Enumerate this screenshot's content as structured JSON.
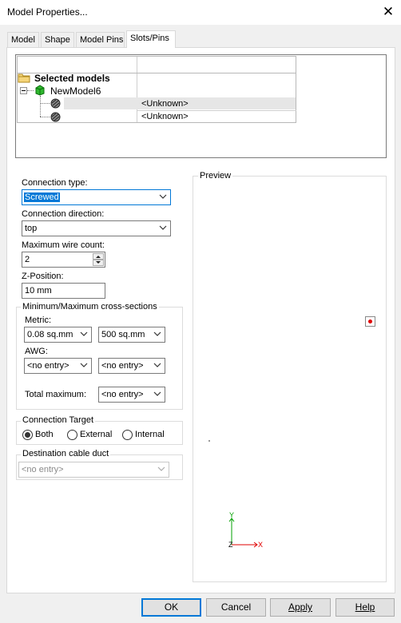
{
  "window": {
    "title": "Model Properties..."
  },
  "tabs": [
    "Model",
    "Shape",
    "Model Pins",
    "Slots/Pins"
  ],
  "tree": {
    "root_label": "Selected models",
    "model_label": "NewModel6",
    "rows": [
      {
        "value": "<Unknown>"
      },
      {
        "value": "<Unknown>"
      }
    ]
  },
  "form": {
    "connection_type": {
      "label": "Connection type:",
      "value": "Screwed"
    },
    "connection_direction": {
      "label": "Connection direction:",
      "value": "top"
    },
    "max_wire_count": {
      "label": "Maximum wire count:",
      "value": "2"
    },
    "z_position": {
      "label": "Z-Position:",
      "value": "10 mm"
    },
    "cross_sections": {
      "title": "Minimum/Maximum cross-sections",
      "metric_label": "Metric:",
      "metric_min": "0.08 sq.mm",
      "metric_max": "500 sq.mm",
      "awg_label": "AWG:",
      "awg_min": "<no entry>",
      "awg_max": "<no entry>",
      "total_label": "Total maximum:",
      "total_value": "<no entry>"
    },
    "connection_target": {
      "title": "Connection Target",
      "options": [
        "Both",
        "External",
        "Internal"
      ],
      "selected": "Both"
    },
    "destination_duct": {
      "title": "Destination cable duct",
      "value": "<no entry>"
    }
  },
  "preview": {
    "title": "Preview",
    "axis_x": "X",
    "axis_y": "Y",
    "axis_z": "Z",
    "accent_color": "#e00000",
    "axis_green": "#00a000"
  },
  "buttons": {
    "ok": "OK",
    "cancel": "Cancel",
    "apply": "Apply",
    "help": "Help"
  }
}
